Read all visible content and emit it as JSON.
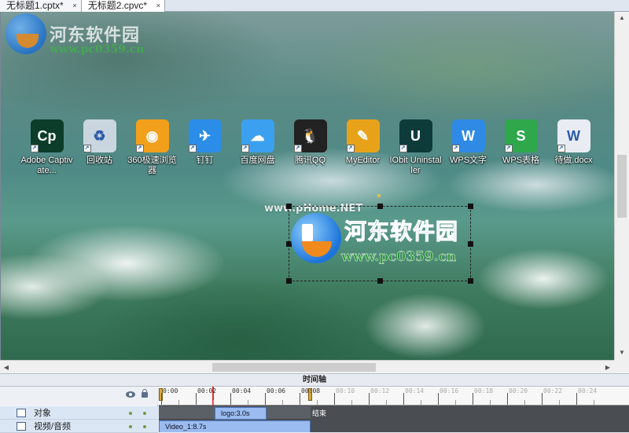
{
  "tabs": [
    {
      "label": "无标题1.cptx*",
      "close": "×",
      "active": false
    },
    {
      "label": "无标题2.cpvc*",
      "close": "×",
      "active": true
    }
  ],
  "watermark": {
    "title": "河东软件园",
    "url": "www.pc0359.cn"
  },
  "desktop_icons": [
    {
      "label": "Adobe Captivate...",
      "icon": "adobe-captivate-icon",
      "glyph": "Cp",
      "color": "#0b3d2a"
    },
    {
      "label": "回收站",
      "icon": "recycle-bin-icon",
      "glyph": "♻",
      "color": "#c9d6e0"
    },
    {
      "label": "360极速浏览器",
      "icon": "browser-360-icon",
      "glyph": "◉",
      "color": "#f2a01c"
    },
    {
      "label": "钉钉",
      "icon": "dingtalk-icon",
      "glyph": "✈",
      "color": "#2b8de8"
    },
    {
      "label": "百度网盘",
      "icon": "baidu-netdisk-icon",
      "glyph": "☁",
      "color": "#3ba0f0"
    },
    {
      "label": "腾讯QQ",
      "icon": "qq-icon",
      "glyph": "🐧",
      "color": "#222222"
    },
    {
      "label": "MyEditor",
      "icon": "myeditor-icon",
      "glyph": "✎",
      "color": "#e8a21a"
    },
    {
      "label": "IObit Uninstaller",
      "icon": "iobit-uninstaller-icon",
      "glyph": "U",
      "color": "#0c3b3a"
    },
    {
      "label": "WPS文字",
      "icon": "wps-writer-icon",
      "glyph": "W",
      "color": "#2f8ae6"
    },
    {
      "label": "WPS表格",
      "icon": "wps-spreadsheet-icon",
      "glyph": "S",
      "color": "#2ea84b"
    },
    {
      "label": "待做.docx",
      "icon": "docx-file-icon",
      "glyph": "W",
      "color": "#e9edf3"
    }
  ],
  "selected_object": {
    "watermark": "www.pHome.NET",
    "logo_title": "河东软件园",
    "logo_url": "www.pc0359.cn"
  },
  "timeline": {
    "header": "时间轴",
    "ruler_labels": [
      "0:00",
      "00:02",
      "00:04",
      "00:06",
      "00:08",
      "00:10",
      "00:12",
      "00:14",
      "00:16",
      "00:18",
      "00:20",
      "00:22",
      "00:24"
    ],
    "tracks": [
      {
        "name": "对象",
        "clip": "logo:3.0s"
      },
      {
        "name": "视频/音频",
        "clip": "Video_1:8.7s"
      }
    ],
    "end_label": "结束"
  }
}
